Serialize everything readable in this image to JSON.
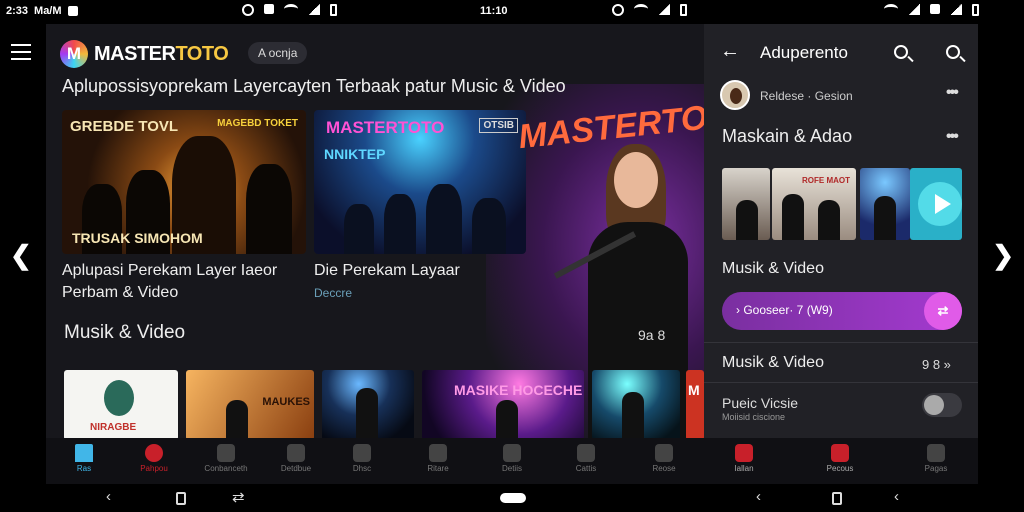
{
  "status_bar": {
    "time_left": "2:33",
    "carrier": "Ma/M",
    "time_center": "11:10"
  },
  "app": {
    "brand_prefix": "MASTER",
    "brand_suffix": "TOTO",
    "logo_letter": "M",
    "search_chip": "A ocnja",
    "headline": "Aplupossisyoprekam Layercayten Terbaak patur Music & Video"
  },
  "featured": [
    {
      "title": "GREBDE TOVL",
      "sub": "MAGEBD TOKET",
      "bottom": "TRUSAK SIMOHOM",
      "caption": "Aplupasi Perekam Layer Iaeor Perbam & Video"
    },
    {
      "title": "MASTERTOTO",
      "sub": "OTSIB",
      "bottom": "NNIKTEP",
      "caption": "Die Perekam Layaar",
      "caption_sub": "Deccre"
    }
  ],
  "hero_brand": "MASTERTOTO",
  "section": {
    "label": "Musik & Video",
    "count": "9a 8"
  },
  "thumbs": [
    {
      "label": "NIRAGBE"
    },
    {
      "label": "MAUKES"
    },
    {
      "label": ""
    },
    {
      "label": "MASIKE HOCECHE"
    },
    {
      "label": ""
    },
    {
      "label": "M"
    }
  ],
  "side": {
    "title": "Aduperento",
    "profile_name": "Reldese · Gesion",
    "section_1": "Maskain & Adao",
    "section_2": "Musik & Video",
    "player_text": "› Gooseer· 7 (W9)",
    "shuffle": "⇄",
    "section_3": "Musik & Video",
    "section_3_count": "9 8 »",
    "toggle_label": "Pueic Vicsie",
    "toggle_sub": "Moiisid ciscione",
    "strip_label": "ROFE MAOT",
    "toggle_on": false
  },
  "bottom_nav": [
    {
      "label": "Ras",
      "state": "active"
    },
    {
      "label": "Pahpou",
      "state": "red"
    },
    {
      "label": "Conbanceth",
      "state": ""
    },
    {
      "label": "Detdbue",
      "state": ""
    },
    {
      "label": "Dhsc",
      "state": ""
    },
    {
      "label": "Ritare",
      "state": ""
    },
    {
      "label": "Detiis",
      "state": ""
    },
    {
      "label": "Cattis",
      "state": ""
    },
    {
      "label": "Reose",
      "state": ""
    },
    {
      "label": "Iallan",
      "state": "red2"
    },
    {
      "label": "Pecous",
      "state": "red2"
    },
    {
      "label": "Pagas",
      "state": ""
    }
  ],
  "icons": {
    "menu": "menu-icon",
    "back": "arrow-back-icon",
    "search": "search-icon",
    "more": "more-vert-icon",
    "play": "play-icon",
    "prev": "chevron-left-icon",
    "next": "chevron-right-icon"
  },
  "colors": {
    "accent_blue": "#41b6e8",
    "accent_purple": "#a43ad0",
    "accent_pink": "#e05be8",
    "brand_red": "#c8202a",
    "panel_bg": "#17171c",
    "side_bg": "#212126"
  }
}
